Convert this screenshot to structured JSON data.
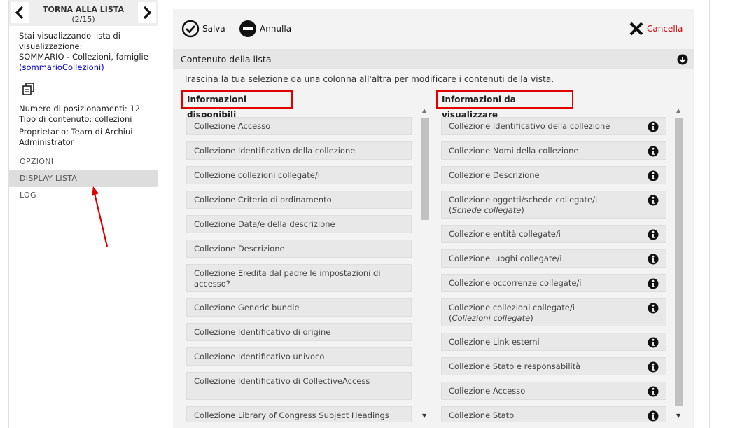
{
  "nav": {
    "back_label": "TORNA ALLA LISTA",
    "counter": "(2/15)"
  },
  "info": {
    "viewing_label": "Stai visualizzando lista di visualizzazione:",
    "list_name": "SOMMARIO - Collezioni, famiglie",
    "list_code": "(sommarioCollezioni)",
    "positions_label": "Numero di posizionamenti:",
    "positions_value": "12",
    "content_type_label": "Tipo di contenuto:",
    "content_type_value": "collezioni",
    "owner_label": "Proprietario:",
    "owner_value": "Team di Archiui Administrator"
  },
  "menu": [
    {
      "label": "OPZIONI"
    },
    {
      "label": "DISPLAY LISTA"
    },
    {
      "label": "LOG"
    }
  ],
  "toolbar": {
    "save_label": "Salva",
    "cancel_label": "Annulla",
    "delete_label": "Cancella"
  },
  "section": {
    "title": "Contenuto della lista",
    "instructions": "Trascina la tua selezione da una colonna all'altra per modificare i contenuti della vista."
  },
  "available": {
    "title": "Informazioni disponibili",
    "items": [
      {
        "prefix": "Collezione",
        "label": "Accesso"
      },
      {
        "prefix": "Collezione",
        "label": "Identificativo della collezione"
      },
      {
        "prefix": "Collezione",
        "label": "collezioni collegate/i"
      },
      {
        "prefix": "Collezione",
        "label": "Criterio di ordinamento"
      },
      {
        "prefix": "Collezione",
        "label": "Data/e della descrizione"
      },
      {
        "prefix": "Collezione",
        "label": "Descrizione"
      },
      {
        "prefix": "Collezione",
        "label": "Eredita dal padre le impostazioni di accesso?"
      },
      {
        "prefix": "Collezione",
        "label": "Generic bundle"
      },
      {
        "prefix": "Collezione",
        "label": "Identificativo di origine"
      },
      {
        "prefix": "Collezione",
        "label": "Identificativo univoco"
      },
      {
        "prefix": "Collezione",
        "label": "Identificativo di CollectiveAccess"
      },
      {
        "prefix": "Collezione",
        "label": "Library of Congress Subject Headings"
      }
    ]
  },
  "display": {
    "title": "Informazioni da visualizzare",
    "items": [
      {
        "prefix": "Collezione",
        "label": "Identificativo della collezione",
        "sub": ""
      },
      {
        "prefix": "Collezione",
        "label": "Nomi della collezione",
        "sub": ""
      },
      {
        "prefix": "Collezione",
        "label": "Descrizione",
        "sub": ""
      },
      {
        "prefix": "Collezione",
        "label": "oggetti/schede collegate/i",
        "sub": "Schede collegate"
      },
      {
        "prefix": "Collezione",
        "label": "entità collegate/i",
        "sub": ""
      },
      {
        "prefix": "Collezione",
        "label": "luoghi collegate/i",
        "sub": ""
      },
      {
        "prefix": "Collezione",
        "label": "occorrenze collegate/i",
        "sub": ""
      },
      {
        "prefix": "Collezione",
        "label": "collezioni collegate/i",
        "sub": "Collezioni collegate"
      },
      {
        "prefix": "Collezione",
        "label": "Link esterni",
        "sub": ""
      },
      {
        "prefix": "Collezione",
        "label": "Stato e responsabilità",
        "sub": ""
      },
      {
        "prefix": "Collezione",
        "label": "Accesso",
        "sub": ""
      },
      {
        "prefix": "Collezione",
        "label": "Stato",
        "sub": ""
      }
    ]
  },
  "colors": {
    "accent_red": "#e00000",
    "link_blue": "#0000cc",
    "delete_red": "#cc0000"
  }
}
